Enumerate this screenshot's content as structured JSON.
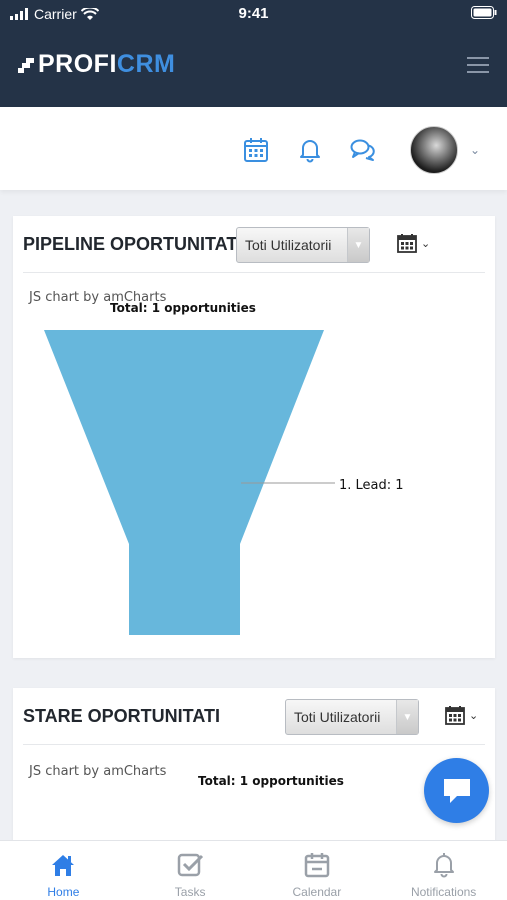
{
  "status_bar": {
    "carrier": "Carrier",
    "time": "9:41"
  },
  "header": {
    "logo_part1": "PROFI",
    "logo_part2": "CRM"
  },
  "pipeline_card": {
    "title": "PIPELINE OPORTUNITATI",
    "select_value": "Toti Utilizatorii",
    "chart_credit": "JS chart by amCharts",
    "total_label": "Total: 1 opportunities",
    "slice_label": "1. Lead: 1"
  },
  "stare_card": {
    "title": "STARE OPORTUNITATI",
    "select_value": "Toti Utilizatorii",
    "chart_credit": "JS chart by amCharts",
    "total_label": "Total: 1 opportunities"
  },
  "bottom_nav": {
    "items": [
      {
        "label": "Home",
        "icon": "home-icon",
        "active": true
      },
      {
        "label": "Tasks",
        "icon": "tasks-icon",
        "active": false
      },
      {
        "label": "Calendar",
        "icon": "calendar-icon",
        "active": false
      },
      {
        "label": "Notifications",
        "icon": "bell-icon",
        "active": false
      }
    ]
  },
  "colors": {
    "header_bg": "#243347",
    "accent": "#2f7ee6",
    "funnel": "#67b7dc"
  },
  "chart_data": [
    {
      "type": "funnel",
      "title": "Total: 1 opportunities",
      "categories": [
        "1. Lead"
      ],
      "values": [
        1
      ]
    }
  ]
}
